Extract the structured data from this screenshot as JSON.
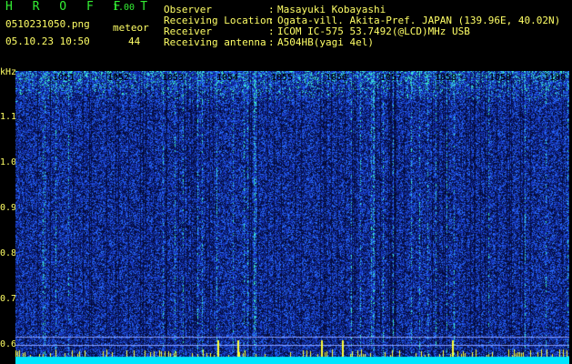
{
  "header": {
    "app_name": "H R O F F T",
    "version": "1.00",
    "file_name": "0510231050.png",
    "meteor_label": "meteor",
    "date_time": "05.10.23 10:50",
    "meteor_count": "44"
  },
  "info": [
    {
      "key": "Observer",
      "value": "Masayuki Kobayashi"
    },
    {
      "key": "Receiving Location",
      "value": "Ogata-vill. Akita-Pref. JAPAN (139.96E, 40.02N)"
    },
    {
      "key": "Receiver",
      "value": "ICOM IC-575 53.7492(@LCD)MHz USB"
    },
    {
      "key": "Receiving antenna",
      "value": "A504HB(yagi 4el)"
    }
  ],
  "spectrogram": {
    "y_unit": "kHz",
    "y_ticks": [
      "1.1",
      "1.0",
      "0.9",
      "0.8",
      "0.7",
      "0.6"
    ],
    "x_ticks": [
      "1051",
      "1052",
      "1053",
      "1054",
      "1055",
      "1056",
      "1057",
      "1058",
      "1059",
      "1100"
    ],
    "colors": {
      "background": "#0a1a66",
      "noise": "#2c5cff",
      "signal": "#33ffcc",
      "baseline": "#00e5ff",
      "peaks": "#ffff33"
    }
  }
}
